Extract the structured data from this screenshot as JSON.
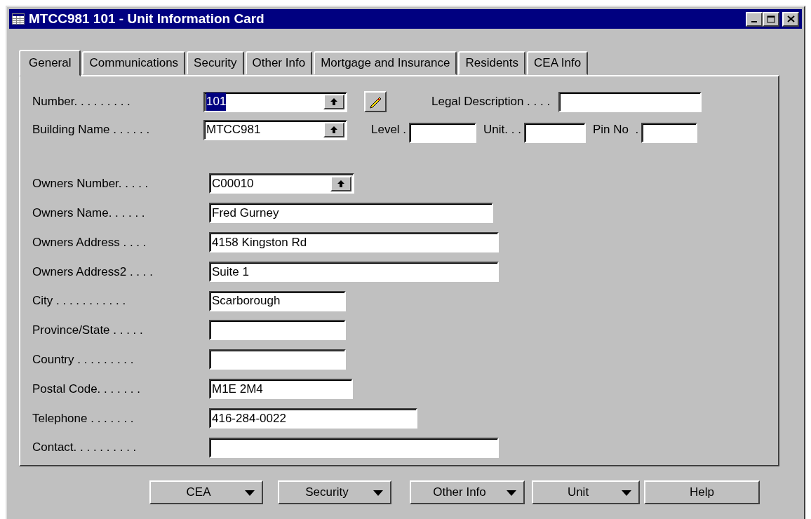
{
  "window": {
    "title": "MTCC981 101 - Unit Information Card"
  },
  "tabs": [
    {
      "label": "General",
      "selected": true
    },
    {
      "label": "Communications",
      "selected": false
    },
    {
      "label": "Security",
      "selected": false
    },
    {
      "label": "Other Info",
      "selected": false
    },
    {
      "label": "Mortgage and Insurance",
      "selected": false
    },
    {
      "label": "Residents",
      "selected": false
    },
    {
      "label": "CEA Info",
      "selected": false
    }
  ],
  "top_fields": [
    {
      "label": "Number. . . . . . . . .",
      "value": "101",
      "lookup": true,
      "text_selected": true
    },
    {
      "label": "Building Name . . . . . .",
      "value": "MTCC981",
      "lookup": true,
      "text_selected": false
    }
  ],
  "legal_description": {
    "label": "Legal Description . . . ."
  },
  "small_fields": [
    {
      "label": "Level ."
    },
    {
      "label": "Unit. . ."
    },
    {
      "label": "Pin No  ."
    }
  ],
  "owner_fields": [
    {
      "label": "Owners Number. . . . .",
      "value": "C00010",
      "lookup": true
    },
    {
      "label": "Owners Name. . . . . .",
      "value": "Fred Gurney",
      "lookup": false
    },
    {
      "label": "Owners Address . . . .",
      "value": "4158 Kingston Rd",
      "lookup": false
    },
    {
      "label": "Owners Address2 . . . .",
      "value": "Suite 1",
      "lookup": false
    },
    {
      "label": "City . . . . . . . . . . .",
      "value": "Scarborough",
      "lookup": false
    },
    {
      "label": "Province/State . . . . .",
      "lookup": false
    },
    {
      "label": "Country . . . . . . . . .",
      "lookup": false
    },
    {
      "label": "Postal Code. . . . . . .",
      "value": "M1E 2M4",
      "lookup": false
    },
    {
      "label": "Telephone . . . . . . .",
      "value": "416-284-0022",
      "lookup": false
    },
    {
      "label": "Contact. . . . . . . . . .",
      "lookup": false
    }
  ],
  "buttons": [
    {
      "label": "CEA",
      "dropdown": true
    },
    {
      "label": "Security",
      "dropdown": true
    },
    {
      "label": "Other Info",
      "dropdown": true
    },
    {
      "label": "Unit",
      "dropdown": true
    },
    {
      "label": "Help",
      "dropdown": false
    }
  ]
}
